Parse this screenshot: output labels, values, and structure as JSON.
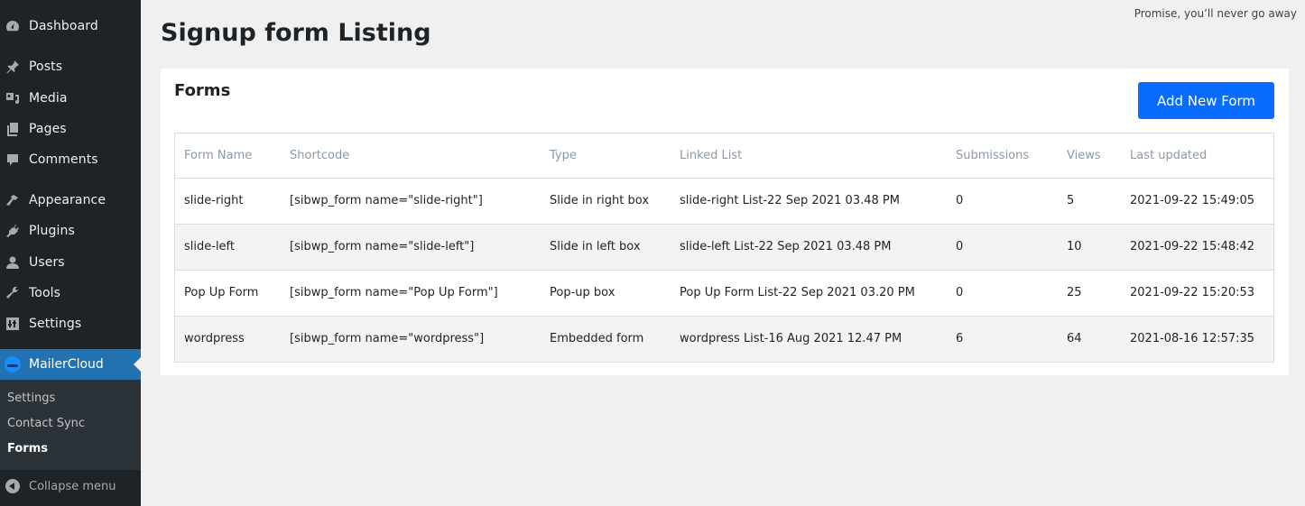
{
  "sidebar": {
    "items": [
      {
        "label": "Dashboard",
        "icon": "dashboard-icon"
      },
      {
        "label": "Posts",
        "icon": "pin-icon"
      },
      {
        "label": "Media",
        "icon": "media-icon"
      },
      {
        "label": "Pages",
        "icon": "pages-icon"
      },
      {
        "label": "Comments",
        "icon": "comment-icon"
      },
      {
        "label": "Appearance",
        "icon": "brush-icon"
      },
      {
        "label": "Plugins",
        "icon": "plugin-icon"
      },
      {
        "label": "Users",
        "icon": "user-icon"
      },
      {
        "label": "Tools",
        "icon": "wrench-icon"
      },
      {
        "label": "Settings",
        "icon": "sliders-icon"
      }
    ],
    "active": {
      "label": "MailerCloud",
      "icon": "mailercloud-logo-icon"
    },
    "submenu": [
      {
        "label": "Settings"
      },
      {
        "label": "Contact Sync"
      },
      {
        "label": "Forms",
        "current": true
      }
    ],
    "collapse_label": "Collapse menu"
  },
  "header": {
    "tagline": "Promise, you’ll never go away",
    "title": "Signup form Listing"
  },
  "card": {
    "title": "Forms",
    "add_button": "Add New Form"
  },
  "table": {
    "columns": [
      "Form Name",
      "Shortcode",
      "Type",
      "Linked List",
      "Submissions",
      "Views",
      "Last updated"
    ],
    "rows": [
      [
        "slide-right",
        "[sibwp_form name=\"slide-right\"]",
        "Slide in right box",
        "slide-right List-22 Sep 2021 03.48 PM",
        "0",
        "5",
        "2021-09-22 15:49:05"
      ],
      [
        "slide-left",
        "[sibwp_form name=\"slide-left\"]",
        "Slide in left box",
        "slide-left List-22 Sep 2021 03.48 PM",
        "0",
        "10",
        "2021-09-22 15:48:42"
      ],
      [
        "Pop Up Form",
        "[sibwp_form name=\"Pop Up Form\"]",
        "Pop-up box",
        "Pop Up Form List-22 Sep 2021 03.20 PM",
        "0",
        "25",
        "2021-09-22 15:20:53"
      ],
      [
        "wordpress",
        "[sibwp_form name=\"wordpress\"]",
        "Embedded form",
        "wordpress List-16 Aug 2021 12.47 PM",
        "6",
        "64",
        "2021-08-16 12:57:35"
      ]
    ]
  },
  "colors": {
    "sidebar_bg": "#1d2327",
    "active_menu": "#2271b1",
    "button_primary": "#0a6cff"
  }
}
